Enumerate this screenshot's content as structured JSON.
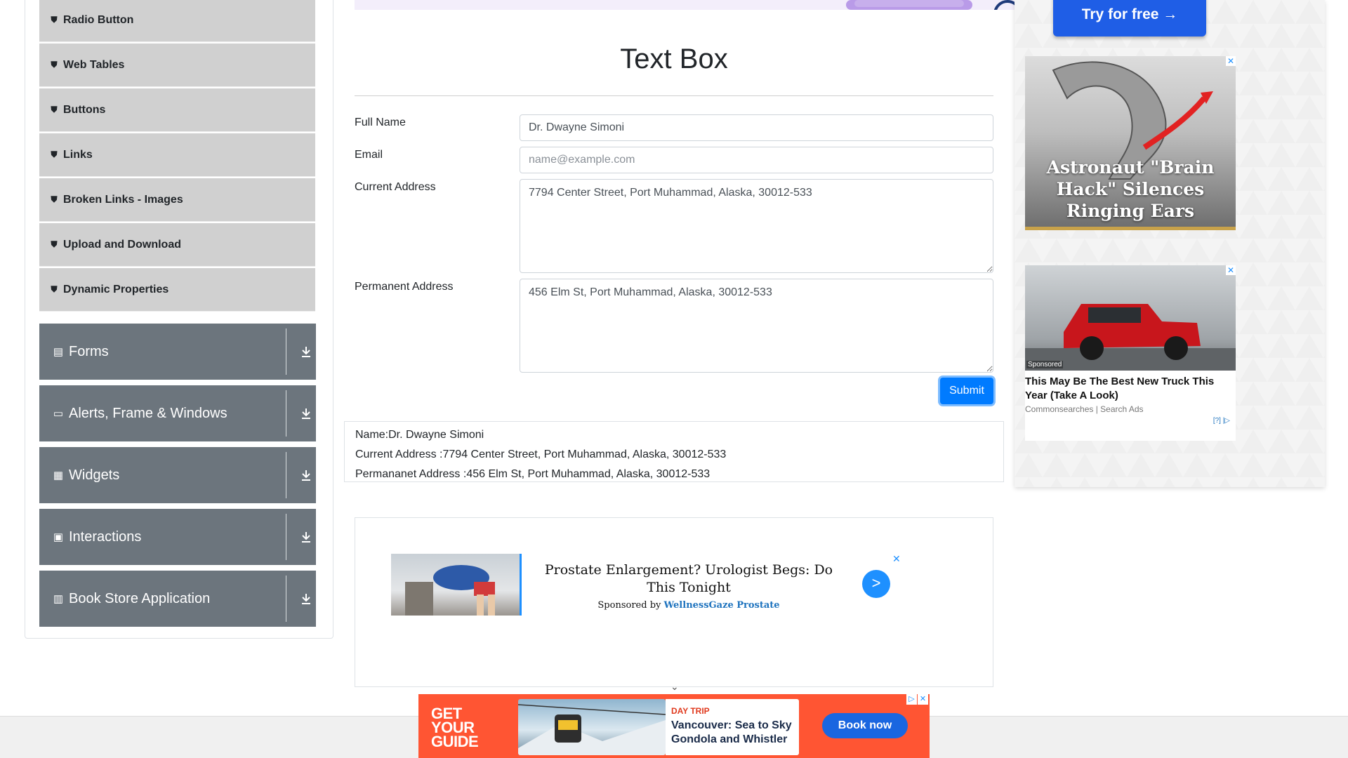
{
  "sidebar": {
    "elements_items": [
      {
        "label": "Radio Button",
        "icon": "html5-icon"
      },
      {
        "label": "Web Tables",
        "icon": "html5-icon"
      },
      {
        "label": "Buttons",
        "icon": "html5-icon"
      },
      {
        "label": "Links",
        "icon": "html5-icon"
      },
      {
        "label": "Broken Links - Images",
        "icon": "html5-icon"
      },
      {
        "label": "Upload and Download",
        "icon": "html5-icon"
      },
      {
        "label": "Dynamic Properties",
        "icon": "html5-icon"
      }
    ],
    "groups": [
      {
        "label": "Forms",
        "icon": "form-icon"
      },
      {
        "label": "Alerts, Frame & Windows",
        "icon": "window-icon"
      },
      {
        "label": "Widgets",
        "icon": "widgets-icon"
      },
      {
        "label": "Interactions",
        "icon": "interactions-icon"
      },
      {
        "label": "Book Store Application",
        "icon": "books-icon"
      }
    ]
  },
  "main": {
    "title": "Text Box",
    "form": {
      "full_name_label": "Full Name",
      "full_name_value": "Dr. Dwayne Simoni",
      "email_label": "Email",
      "email_placeholder": "name@example.com",
      "current_address_label": "Current Address",
      "current_address_value": "7794 Center Street, Port Muhammad, Alaska, 30012-533",
      "permanent_address_label": "Permanent Address",
      "permanent_address_value": "456 Elm St, Port Muhammad, Alaska, 30012-533",
      "submit_label": "Submit"
    },
    "output": {
      "name": "Name:Dr. Dwayne Simoni",
      "current_address": "Current Address :7794 Center Street, Port Muhammad, Alaska, 30012-533",
      "permanent_address": "Permananet Address :456 Elm St, Port Muhammad, Alaska, 30012-533"
    }
  },
  "ads": {
    "content_ad": {
      "headline": "Prostate Enlargement? Urologist Begs: Do This Tonight",
      "sponsored_prefix": "Sponsored by ",
      "sponsor": "WellnessGaze Prostate",
      "go": ">",
      "close": "✕",
      "chevron": "⌄"
    },
    "right": {
      "try_button": "Try for free →",
      "ear_headline": "Astronaut \"Brain Hack\" Silences Ringing Ears",
      "truck_tag": "Sponsored",
      "truck_headline": "This May Be The Best New Truck This Year (Take A Look)",
      "truck_source": "Commonsearches | Search Ads",
      "truck_help": "[?] |▷"
    },
    "bottom": {
      "brand": "GET\nYOUR\nGUIDE",
      "kicker": "DAY TRIP",
      "destination": "Vancouver: Sea to Sky Gondola and Whistler",
      "cta": "Book now"
    }
  },
  "colors": {
    "primary": "#007bff",
    "sidebar_group": "#6c757d",
    "sidebar_item": "#d0d0d0",
    "bottom_ad": "#ff5533"
  }
}
